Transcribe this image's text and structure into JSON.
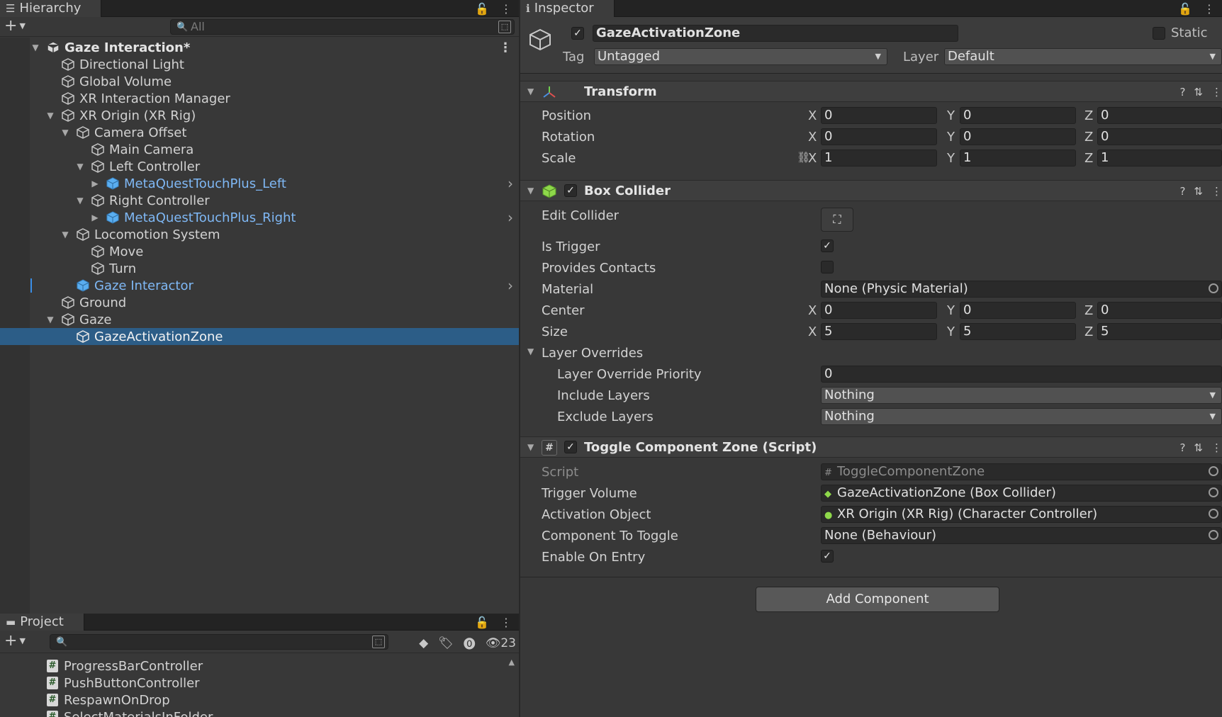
{
  "hierarchy": {
    "tab_label": "Hierarchy",
    "search_placeholder": "All",
    "rows": [
      {
        "label": "Gaze Interaction*",
        "kind": "scene"
      },
      {
        "label": "Directional Light"
      },
      {
        "label": "Global Volume"
      },
      {
        "label": "XR Interaction Manager"
      },
      {
        "label": "XR Origin (XR Rig)"
      },
      {
        "label": "Camera Offset"
      },
      {
        "label": "Main Camera"
      },
      {
        "label": "Left Controller"
      },
      {
        "label": "MetaQuestTouchPlus_Left",
        "kind": "prefab"
      },
      {
        "label": "Right Controller"
      },
      {
        "label": "MetaQuestTouchPlus_Right",
        "kind": "prefab"
      },
      {
        "label": "Locomotion System"
      },
      {
        "label": "Move"
      },
      {
        "label": "Turn"
      },
      {
        "label": "Gaze Interactor",
        "kind": "prefab"
      },
      {
        "label": "Ground"
      },
      {
        "label": "Gaze"
      },
      {
        "label": "GazeActivationZone",
        "kind": "selected"
      }
    ]
  },
  "project": {
    "tab_label": "Project",
    "hidden_count": "23",
    "items": [
      "ProgressBarController",
      "PushButtonController",
      "RespawnOnDrop",
      "SelectMaterialsInFolder"
    ]
  },
  "inspector": {
    "tab_label": "Inspector",
    "object_name": "GazeActivationZone",
    "static_label": "Static",
    "tag_label": "Tag",
    "tag_value": "Untagged",
    "layer_label": "Layer",
    "layer_value": "Default",
    "transform": {
      "title": "Transform",
      "position_label": "Position",
      "rotation_label": "Rotation",
      "scale_label": "Scale",
      "position": [
        "0",
        "0",
        "0"
      ],
      "rotation": [
        "0",
        "0",
        "0"
      ],
      "scale": [
        "1",
        "1",
        "1"
      ]
    },
    "box_collider": {
      "title": "Box Collider",
      "edit_collider_label": "Edit Collider",
      "is_trigger_label": "Is Trigger",
      "is_trigger": true,
      "provides_contacts_label": "Provides Contacts",
      "provides_contacts": false,
      "material_label": "Material",
      "material_value": "None (Physic Material)",
      "center_label": "Center",
      "center": [
        "0",
        "0",
        "0"
      ],
      "size_label": "Size",
      "size": [
        "5",
        "5",
        "5"
      ],
      "layer_overrides_label": "Layer Overrides",
      "layer_override_priority_label": "Layer Override Priority",
      "layer_override_priority": "0",
      "include_layers_label": "Include Layers",
      "include_layers": "Nothing",
      "exclude_layers_label": "Exclude Layers",
      "exclude_layers": "Nothing"
    },
    "toggle_zone": {
      "title": "Toggle Component Zone (Script)",
      "script_label": "Script",
      "script_value": "ToggleComponentZone",
      "trigger_volume_label": "Trigger Volume",
      "trigger_volume_value": "GazeActivationZone (Box Collider)",
      "activation_object_label": "Activation Object",
      "activation_object_value": "XR Origin (XR Rig) (Character Controller)",
      "component_to_toggle_label": "Component To Toggle",
      "component_to_toggle_value": "None (Behaviour)",
      "enable_on_entry_label": "Enable On Entry",
      "enable_on_entry": true
    },
    "add_component_label": "Add Component"
  },
  "axes": [
    "X",
    "Y",
    "Z"
  ],
  "colors": {
    "selection": "#2c5d87",
    "prefab_text": "#7fb8f5",
    "panel_bg": "#383838"
  }
}
